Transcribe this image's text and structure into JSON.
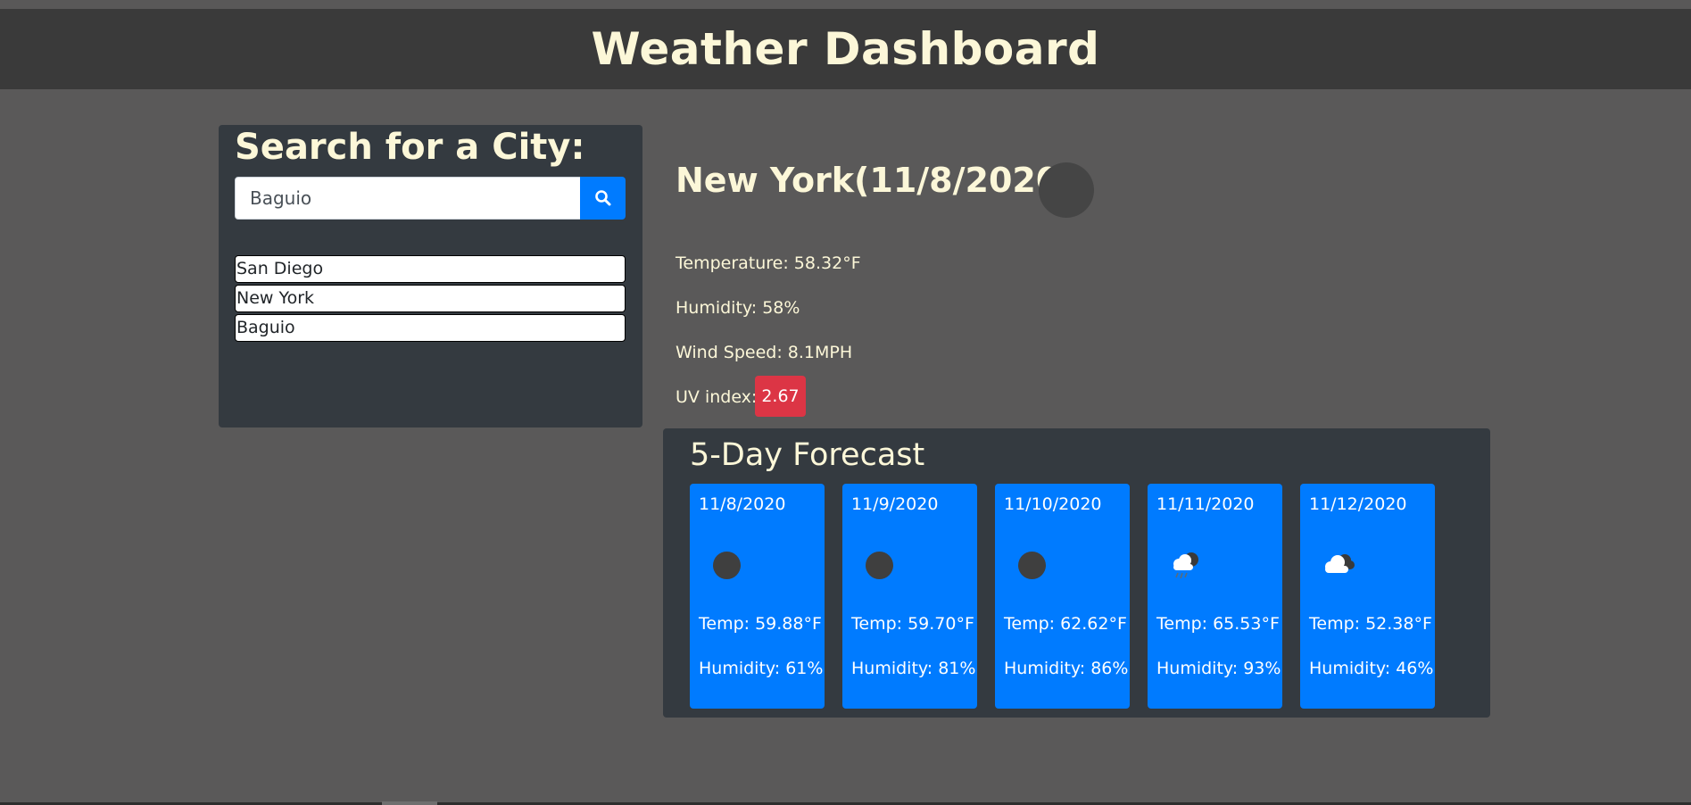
{
  "header": {
    "title": "Weather Dashboard"
  },
  "search": {
    "title": "Search for a City:",
    "input_value": "Baguio",
    "button_icon": "search-icon",
    "history": [
      {
        "label": "San Diego"
      },
      {
        "label": "New York"
      },
      {
        "label": "Baguio"
      }
    ]
  },
  "current": {
    "title": "New York(11/8/2020)",
    "icon": "weather-icon",
    "temperature": "Temperature: 58.32°F",
    "humidity": "Humidity: 58%",
    "wind": "Wind Speed: 8.1MPH",
    "uv_label": "UV index:",
    "uv_value": "2.67"
  },
  "forecast": {
    "title": "5-Day Forecast",
    "days": [
      {
        "date": "11/8/2020",
        "icon": "clear-night-icon",
        "temp": "Temp: 59.88°F",
        "humidity": "Humidity: 61%"
      },
      {
        "date": "11/9/2020",
        "icon": "clear-night-icon",
        "temp": "Temp: 59.70°F",
        "humidity": "Humidity: 81%"
      },
      {
        "date": "11/10/2020",
        "icon": "clear-night-icon",
        "temp": "Temp: 62.62°F",
        "humidity": "Humidity: 86%"
      },
      {
        "date": "11/11/2020",
        "icon": "rain-icon",
        "temp": "Temp: 65.53°F",
        "humidity": "Humidity: 93%"
      },
      {
        "date": "11/12/2020",
        "icon": "cloud-icon",
        "temp": "Temp: 52.38°F",
        "humidity": "Humidity: 46%"
      }
    ]
  },
  "colors": {
    "background": "#5a5959",
    "header_bg": "#3a3a3a",
    "panel_bg": "#343a40",
    "accent": "#007bff",
    "uv_badge": "#dc3545",
    "title_text": "#fcf7d8"
  }
}
